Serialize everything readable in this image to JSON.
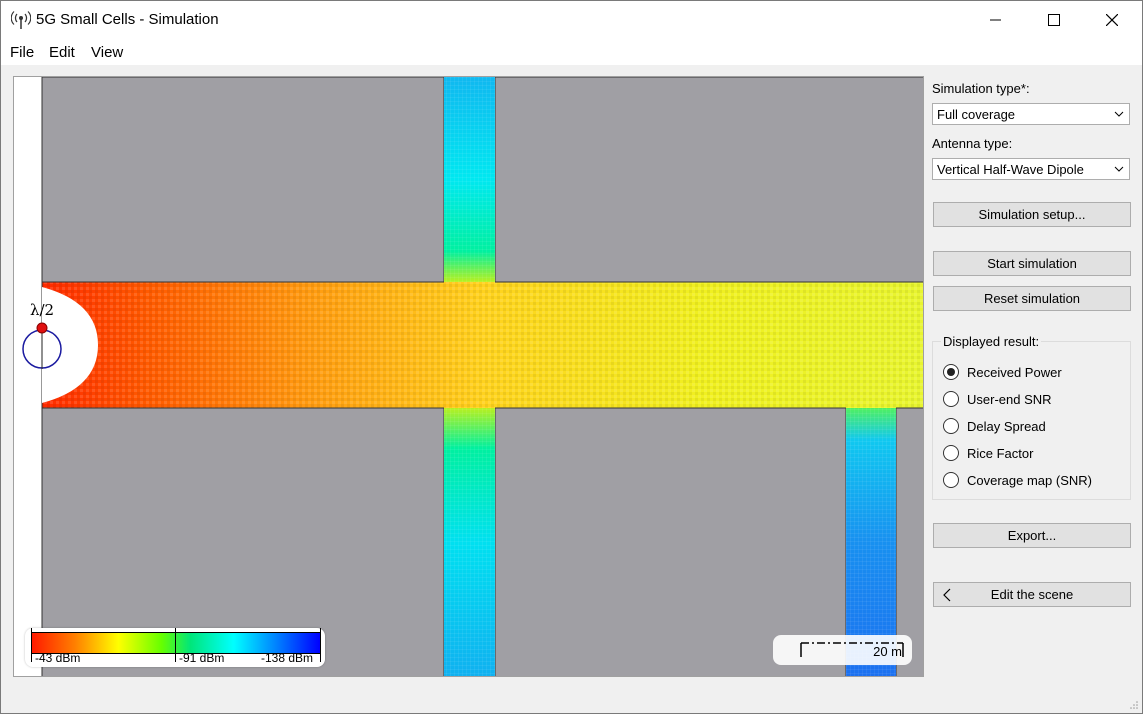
{
  "window": {
    "title": "5G Small Cells - Simulation",
    "icon": "antenna-broadcast-icon"
  },
  "menubar": {
    "items": [
      "File",
      "Edit",
      "View"
    ]
  },
  "viewport": {
    "antenna_label": "λ/2",
    "legend": {
      "min_label": "-43 dBm",
      "mid_label": "-91 dBm",
      "max_label": "-138 dBm"
    },
    "scale_bar": {
      "label": "20 m"
    },
    "colors": {
      "building": "#a09fa4",
      "strong": "#ff1a00",
      "medium": "#ffff00",
      "weak": "#00ffff",
      "very_weak": "#0080ff"
    }
  },
  "panel": {
    "simulation_type_label": "Simulation type*:",
    "simulation_type_value": "Full coverage",
    "antenna_type_label": "Antenna type:",
    "antenna_type_value": "Vertical Half-Wave Dipole",
    "setup_button": "Simulation setup...",
    "start_button": "Start simulation",
    "reset_button": "Reset simulation",
    "displayed_result_title": "Displayed result:",
    "results": [
      {
        "label": "Received Power",
        "checked": true
      },
      {
        "label": "User-end SNR",
        "checked": false
      },
      {
        "label": "Delay Spread",
        "checked": false
      },
      {
        "label": "Rice Factor",
        "checked": false
      },
      {
        "label": "Coverage map (SNR)",
        "checked": false
      }
    ],
    "export_button": "Export...",
    "edit_scene_button": "Edit the scene"
  }
}
